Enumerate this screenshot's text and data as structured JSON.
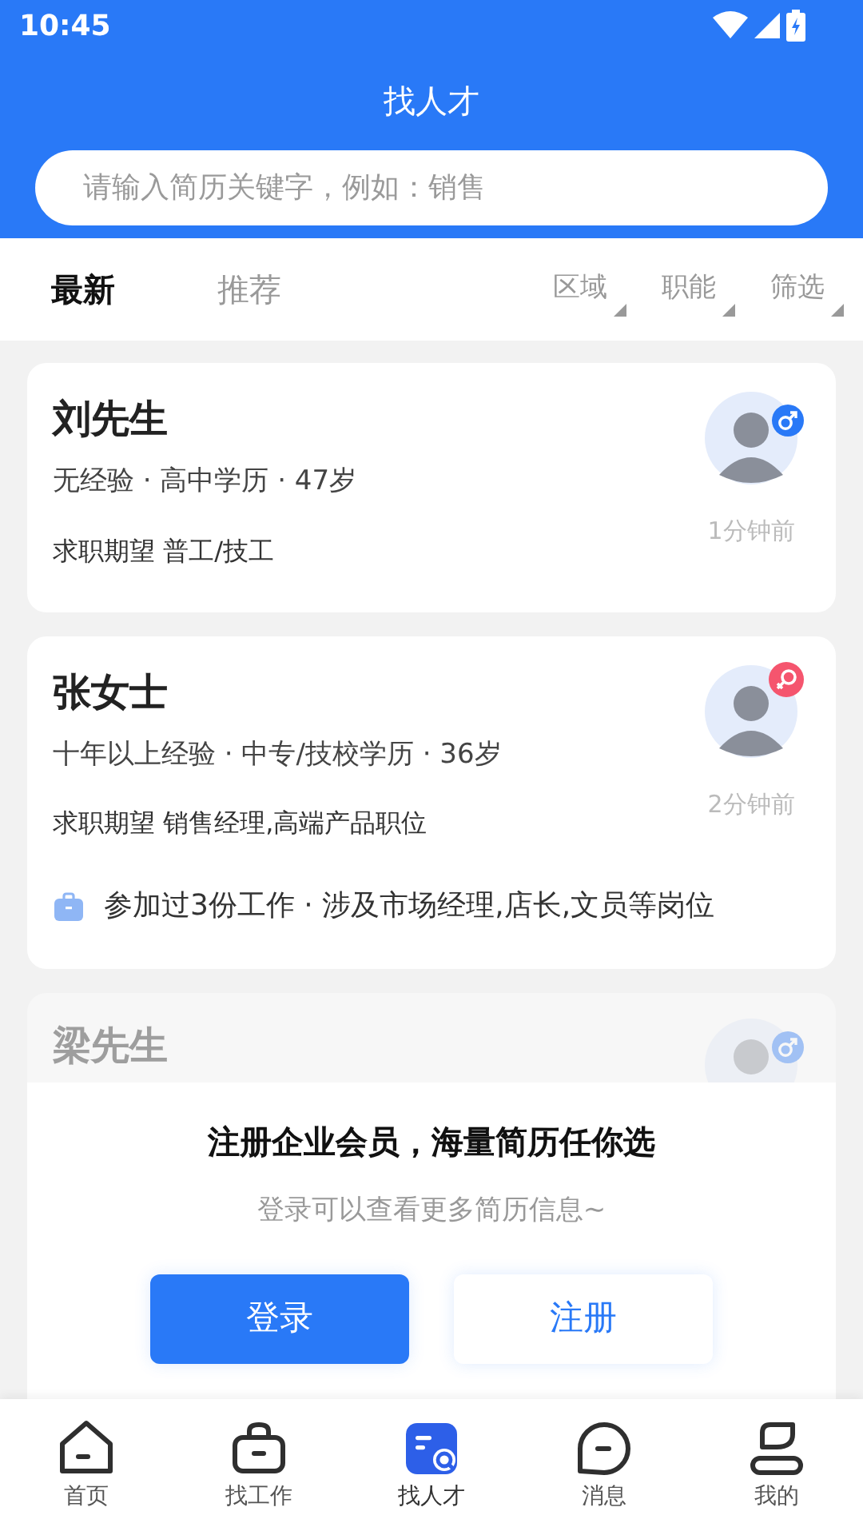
{
  "status_bar": {
    "time": "10:45"
  },
  "header": {
    "title": "找人才"
  },
  "search": {
    "placeholder": "请输入简历关键字，例如：销售"
  },
  "tabs": [
    {
      "label": "最新",
      "selected": true
    },
    {
      "label": "推荐",
      "selected": false
    }
  ],
  "filters": [
    "区域",
    "职能",
    "筛选"
  ],
  "candidates": [
    {
      "name": "刘先生",
      "kind": "male",
      "faded": false,
      "summary": "无经验 · 高中学历 · 47岁",
      "expectation": "求职期望 普工/技工",
      "time": "1分钟前"
    },
    {
      "name": "张女士",
      "kind": "female",
      "faded": false,
      "summary": "十年以上经验 · 中专/技校学历 · 36岁",
      "expectation": "求职期望 销售经理,高端产品职位",
      "time": "2分钟前",
      "history": "参加过3份工作 · 涉及市场经理,店长,文员等岗位"
    },
    {
      "name": "梁先生",
      "kind": "male",
      "faded": true
    }
  ],
  "login_prompt": {
    "title": "注册企业会员，海量简历任你选",
    "subtitle": "登录可以查看更多简历信息~",
    "buttons": [
      {
        "label": "登录",
        "kind": "primary"
      },
      {
        "label": "注册",
        "kind": "secondary"
      }
    ]
  },
  "bottom_nav": [
    {
      "label": "首页",
      "selected": false
    },
    {
      "label": "找工作",
      "selected": false
    },
    {
      "label": "找人才",
      "selected": true
    },
    {
      "label": "消息",
      "selected": false
    },
    {
      "label": "我的",
      "selected": false
    }
  ]
}
